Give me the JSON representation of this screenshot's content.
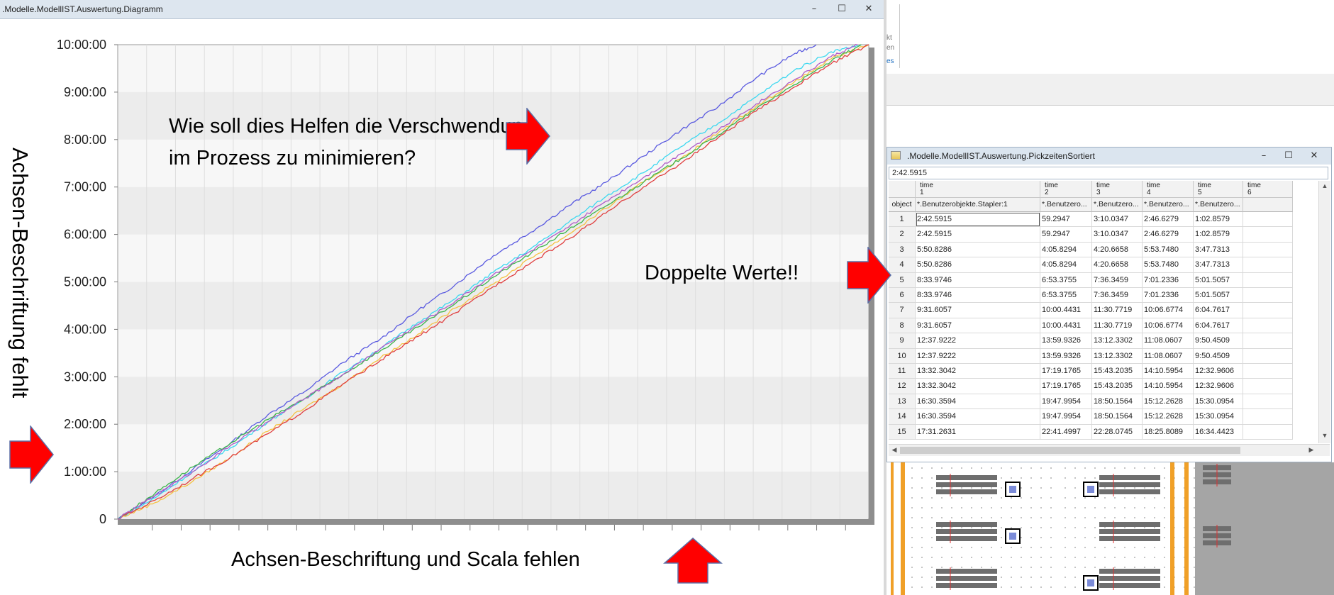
{
  "chart_window": {
    "title": ".Modelle.ModellIST.Auswertung.Diagramm",
    "controls": {
      "minimize": "–",
      "maximize": "☐",
      "close": "✕"
    }
  },
  "chart_data": {
    "type": "line",
    "title": "",
    "xlabel": "",
    "ylabel": "",
    "y_ticks": [
      "0",
      "1:00:00",
      "2:00:00",
      "3:00:00",
      "4:00:00",
      "5:00:00",
      "6:00:00",
      "7:00:00",
      "8:00:00",
      "9:00:00",
      "10:00:00"
    ],
    "ylim_hours": [
      0,
      10
    ],
    "x_labels_shown": false,
    "grid": "bands",
    "series": [
      {
        "color": "#5a5ae0",
        "end_hours": 10.0,
        "points": [
          [
            0,
            0
          ],
          [
            0.05,
            0.5
          ],
          [
            0.1,
            1.05
          ],
          [
            0.15,
            1.6
          ],
          [
            0.2,
            2.2
          ],
          [
            0.25,
            2.7
          ],
          [
            0.3,
            3.3
          ],
          [
            0.35,
            3.8
          ],
          [
            0.4,
            4.4
          ],
          [
            0.45,
            4.95
          ],
          [
            0.5,
            5.55
          ],
          [
            0.55,
            6.05
          ],
          [
            0.6,
            6.6
          ],
          [
            0.65,
            7.1
          ],
          [
            0.7,
            7.65
          ],
          [
            0.75,
            8.2
          ],
          [
            0.8,
            8.7
          ],
          [
            0.85,
            9.3
          ],
          [
            0.9,
            9.8
          ],
          [
            0.93,
            10.0
          ]
        ]
      },
      {
        "color": "#3cd8f0",
        "end_hours": 10.0,
        "points": [
          [
            0,
            0
          ],
          [
            0.05,
            0.45
          ],
          [
            0.1,
            1.0
          ],
          [
            0.15,
            1.5
          ],
          [
            0.2,
            2.05
          ],
          [
            0.25,
            2.55
          ],
          [
            0.3,
            3.1
          ],
          [
            0.35,
            3.6
          ],
          [
            0.4,
            4.15
          ],
          [
            0.45,
            4.65
          ],
          [
            0.5,
            5.2
          ],
          [
            0.55,
            5.7
          ],
          [
            0.6,
            6.25
          ],
          [
            0.65,
            6.8
          ],
          [
            0.7,
            7.3
          ],
          [
            0.75,
            7.85
          ],
          [
            0.8,
            8.35
          ],
          [
            0.85,
            8.9
          ],
          [
            0.9,
            9.45
          ],
          [
            0.95,
            9.85
          ],
          [
            0.99,
            10.0
          ]
        ]
      },
      {
        "color": "#f5c242",
        "end_hours": 10.0,
        "points": [
          [
            0,
            0
          ],
          [
            0.05,
            0.35
          ],
          [
            0.1,
            0.8
          ],
          [
            0.15,
            1.3
          ],
          [
            0.2,
            1.85
          ],
          [
            0.25,
            2.35
          ],
          [
            0.3,
            2.85
          ],
          [
            0.35,
            3.4
          ],
          [
            0.4,
            3.9
          ],
          [
            0.45,
            4.45
          ],
          [
            0.5,
            4.95
          ],
          [
            0.55,
            5.5
          ],
          [
            0.6,
            6.0
          ],
          [
            0.65,
            6.55
          ],
          [
            0.7,
            7.1
          ],
          [
            0.75,
            7.6
          ],
          [
            0.8,
            8.15
          ],
          [
            0.85,
            8.7
          ],
          [
            0.9,
            9.2
          ],
          [
            0.95,
            9.7
          ],
          [
            1.0,
            10.0
          ]
        ]
      },
      {
        "color": "#3cb44b",
        "end_hours": 10.0,
        "points": [
          [
            0,
            0
          ],
          [
            0.05,
            0.55
          ],
          [
            0.1,
            1.1
          ],
          [
            0.15,
            1.6
          ],
          [
            0.2,
            2.1
          ],
          [
            0.25,
            2.55
          ],
          [
            0.3,
            3.05
          ],
          [
            0.35,
            3.55
          ],
          [
            0.4,
            4.05
          ],
          [
            0.45,
            4.55
          ],
          [
            0.5,
            5.1
          ],
          [
            0.55,
            5.6
          ],
          [
            0.6,
            6.1
          ],
          [
            0.65,
            6.6
          ],
          [
            0.7,
            7.1
          ],
          [
            0.75,
            7.6
          ],
          [
            0.8,
            8.1
          ],
          [
            0.85,
            8.65
          ],
          [
            0.9,
            9.15
          ],
          [
            0.95,
            9.65
          ],
          [
            0.99,
            10.0
          ]
        ]
      },
      {
        "color": "#e04040",
        "end_hours": 10.0,
        "points": [
          [
            0,
            0
          ],
          [
            0.05,
            0.4
          ],
          [
            0.1,
            0.85
          ],
          [
            0.15,
            1.3
          ],
          [
            0.2,
            1.8
          ],
          [
            0.25,
            2.3
          ],
          [
            0.3,
            2.85
          ],
          [
            0.35,
            3.35
          ],
          [
            0.4,
            3.85
          ],
          [
            0.45,
            4.35
          ],
          [
            0.5,
            4.9
          ],
          [
            0.55,
            5.4
          ],
          [
            0.6,
            5.9
          ],
          [
            0.65,
            6.45
          ],
          [
            0.7,
            7.0
          ],
          [
            0.75,
            7.5
          ],
          [
            0.8,
            8.05
          ],
          [
            0.85,
            8.6
          ],
          [
            0.9,
            9.1
          ],
          [
            0.95,
            9.6
          ],
          [
            1.0,
            10.0
          ]
        ]
      },
      {
        "color": "#b05cc8",
        "end_hours": 10.0,
        "points": [
          [
            0,
            0
          ],
          [
            0.05,
            0.5
          ],
          [
            0.1,
            1.0
          ],
          [
            0.15,
            1.55
          ],
          [
            0.2,
            2.05
          ],
          [
            0.25,
            2.55
          ],
          [
            0.3,
            3.05
          ],
          [
            0.35,
            3.6
          ],
          [
            0.4,
            4.1
          ],
          [
            0.45,
            4.6
          ],
          [
            0.5,
            5.15
          ],
          [
            0.55,
            5.65
          ],
          [
            0.6,
            6.15
          ],
          [
            0.65,
            6.7
          ],
          [
            0.7,
            7.2
          ],
          [
            0.75,
            7.7
          ],
          [
            0.8,
            8.2
          ],
          [
            0.85,
            8.75
          ],
          [
            0.9,
            9.25
          ],
          [
            0.95,
            9.75
          ],
          [
            0.985,
            10.0
          ]
        ]
      }
    ]
  },
  "ribbon_fragments": [
    "kt",
    "en",
    "es"
  ],
  "table_window": {
    "title": ".Modelle.ModellIST.Auswertung.PickzeitenSortiert",
    "controls": {
      "minimize": "–",
      "maximize": "☐",
      "close": "✕"
    },
    "address_value": "2:42.5915",
    "column_headers": [
      {
        "label": "time",
        "index": "1"
      },
      {
        "label": "time",
        "index": "2"
      },
      {
        "label": "time",
        "index": "3"
      },
      {
        "label": "time",
        "index": "4"
      },
      {
        "label": "time",
        "index": "5"
      },
      {
        "label": "time",
        "index": "6"
      }
    ],
    "row_header_label": "object",
    "sub_headers": [
      "*.Benutzerobjekte.Stapler:1",
      "*.Benutzero...",
      "*.Benutzero...",
      "*.Benutzero...",
      "*.Benutzero...",
      ""
    ],
    "rows": [
      [
        "1",
        "2:42.5915",
        "59.2947",
        "3:10.0347",
        "2:46.6279",
        "1:02.8579"
      ],
      [
        "2",
        "2:42.5915",
        "59.2947",
        "3:10.0347",
        "2:46.6279",
        "1:02.8579"
      ],
      [
        "3",
        "5:50.8286",
        "4:05.8294",
        "4:20.6658",
        "5:53.7480",
        "3:47.7313"
      ],
      [
        "4",
        "5:50.8286",
        "4:05.8294",
        "4:20.6658",
        "5:53.7480",
        "3:47.7313"
      ],
      [
        "5",
        "8:33.9746",
        "6:53.3755",
        "7:36.3459",
        "7:01.2336",
        "5:01.5057"
      ],
      [
        "6",
        "8:33.9746",
        "6:53.3755",
        "7:36.3459",
        "7:01.2336",
        "5:01.5057"
      ],
      [
        "7",
        "9:31.6057",
        "10:00.4431",
        "11:30.7719",
        "10:06.6774",
        "6:04.7617"
      ],
      [
        "8",
        "9:31.6057",
        "10:00.4431",
        "11:30.7719",
        "10:06.6774",
        "6:04.7617"
      ],
      [
        "9",
        "12:37.9222",
        "13:59.9326",
        "13:12.3302",
        "11:08.0607",
        "9:50.4509"
      ],
      [
        "10",
        "12:37.9222",
        "13:59.9326",
        "13:12.3302",
        "11:08.0607",
        "9:50.4509"
      ],
      [
        "11",
        "13:32.3042",
        "17:19.1765",
        "15:43.2035",
        "14:10.5954",
        "12:32.9606"
      ],
      [
        "12",
        "13:32.3042",
        "17:19.1765",
        "15:43.2035",
        "14:10.5954",
        "12:32.9606"
      ],
      [
        "13",
        "16:30.3594",
        "19:47.9954",
        "18:50.1564",
        "15:12.2628",
        "15:30.0954"
      ],
      [
        "14",
        "16:30.3594",
        "19:47.9954",
        "18:50.1564",
        "15:12.2628",
        "15:30.0954"
      ],
      [
        "15",
        "17:31.2631",
        "22:41.4997",
        "22:28.0745",
        "18:25.8089",
        "16:34.4423"
      ]
    ]
  },
  "annotations": {
    "question": "Wie soll dies Helfen die Verschwendung im Prozess zu minimieren?",
    "y_axis_missing": "Achsen-Beschriftung fehlt",
    "duplicate_values": "Doppelte Werte!!",
    "x_axis_missing": "Achsen-Beschriftung und Scala fehlen"
  },
  "colors": {
    "arrow": "#ff0000",
    "arrow_outline": "#5b6ea5",
    "titlebar": "#dde6ef",
    "plot_band": "#efefef"
  }
}
